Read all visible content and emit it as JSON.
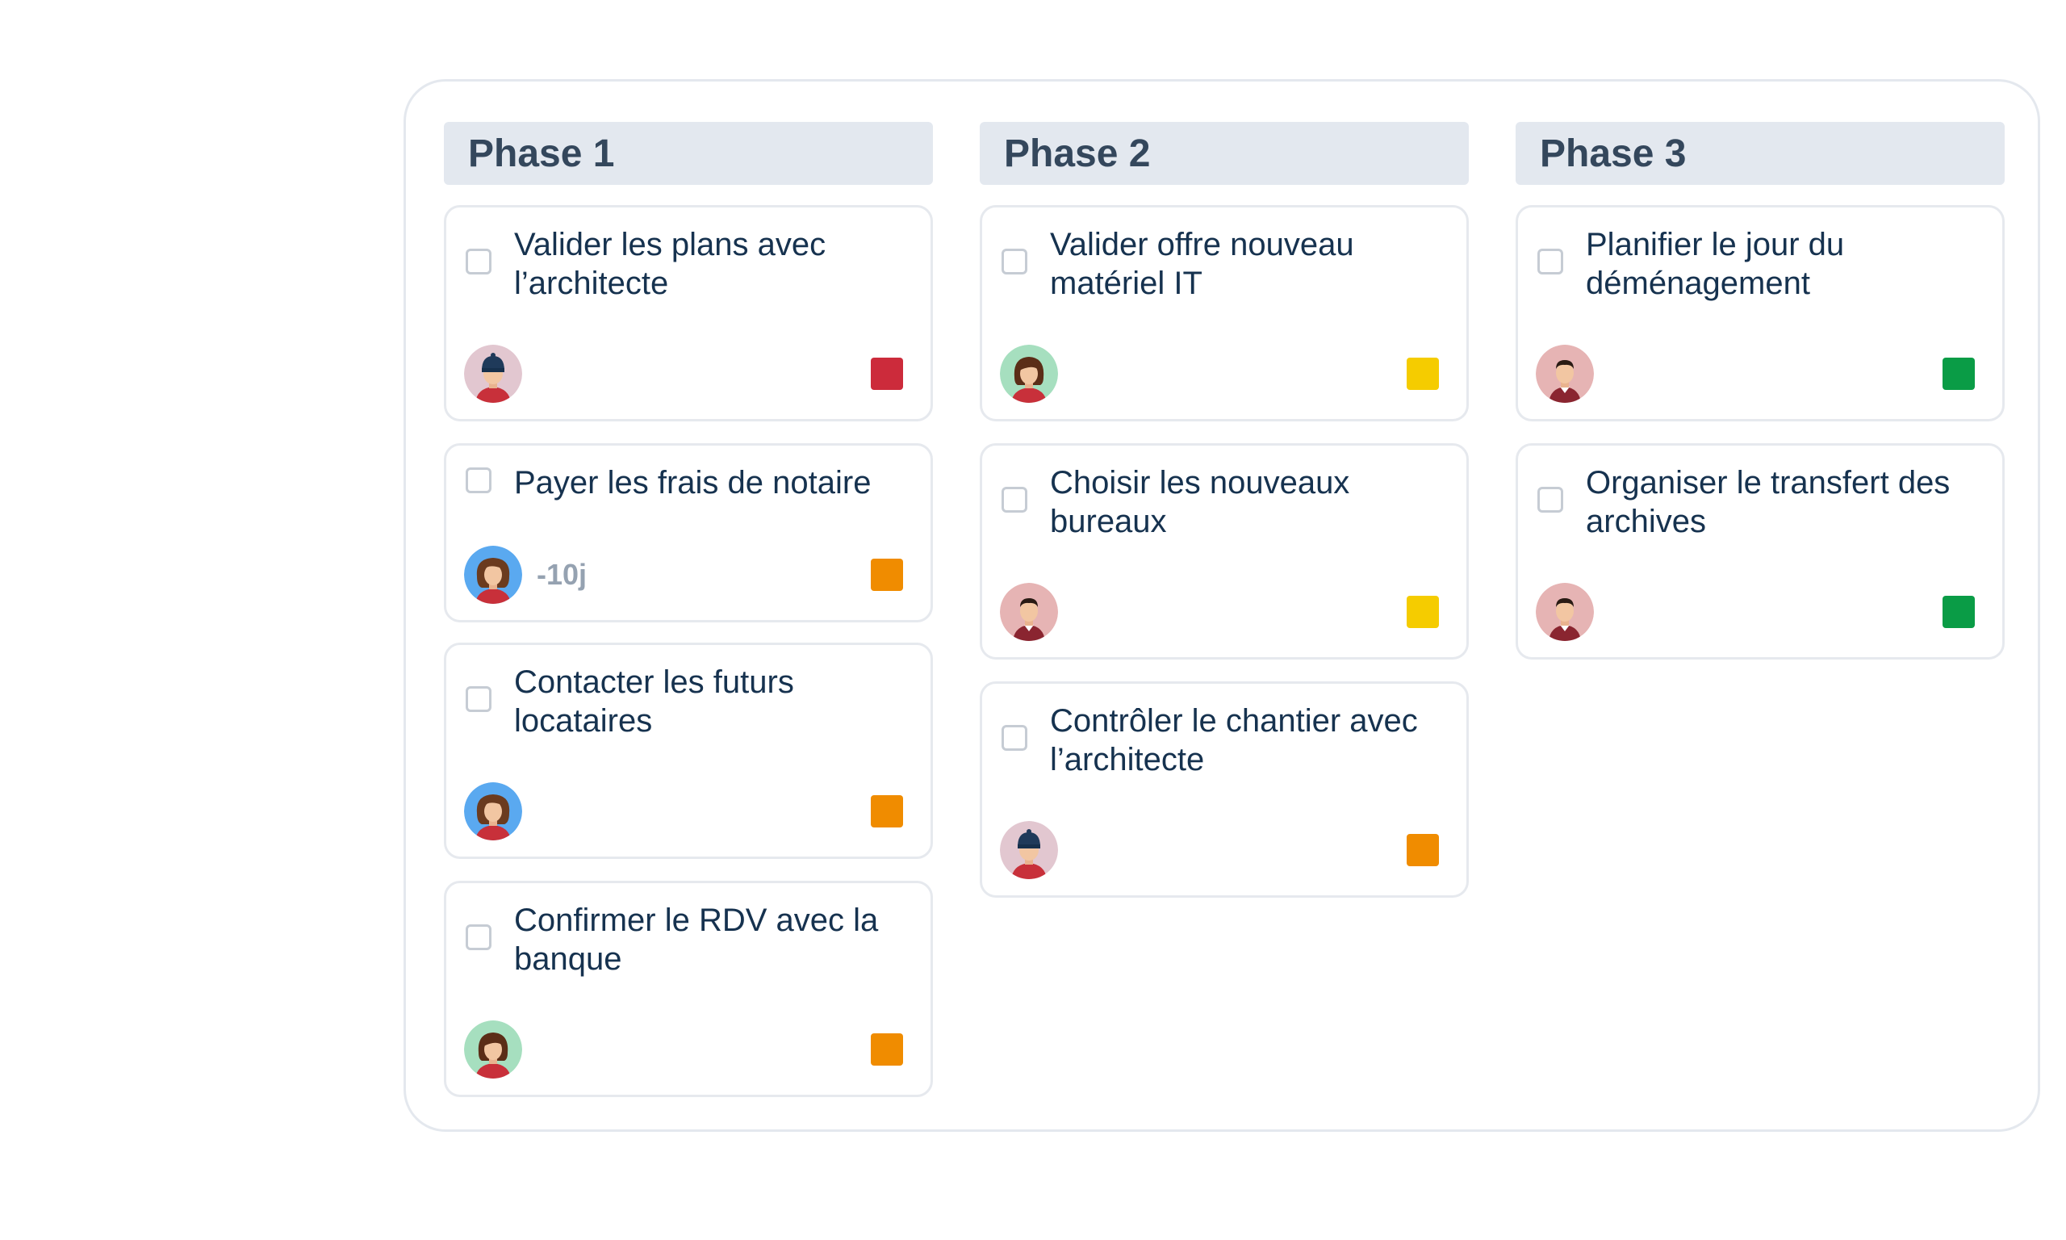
{
  "columns": [
    {
      "title": "Phase 1",
      "cards": [
        {
          "title": "Valider les plans avec l’architecte",
          "avatar": "avatar-woman-beanie",
          "priority_color": "#cc2b3b",
          "delay": ""
        },
        {
          "title": "Payer les frais de notaire",
          "avatar": "avatar-woman-blue-bg",
          "priority_color": "#f08c00",
          "delay": "-10j"
        },
        {
          "title": "Contacter les futurs locataires",
          "avatar": "avatar-woman-blue-bg",
          "priority_color": "#f08c00",
          "delay": ""
        },
        {
          "title": "Confirmer le RDV avec la banque",
          "avatar": "avatar-woman-green-bg",
          "priority_color": "#f08c00",
          "delay": ""
        }
      ]
    },
    {
      "title": "Phase 2",
      "cards": [
        {
          "title": "Valider offre nouveau matériel IT",
          "avatar": "avatar-woman-green-bg",
          "priority_color": "#f5cc00",
          "delay": ""
        },
        {
          "title": "Choisir les nouveaux bureaux",
          "avatar": "avatar-man-pink-bg",
          "priority_color": "#f5cc00",
          "delay": ""
        },
        {
          "title": "Contrôler le chantier avec l’architecte",
          "avatar": "avatar-woman-beanie",
          "priority_color": "#f08c00",
          "delay": ""
        }
      ]
    },
    {
      "title": "Phase 3",
      "cards": [
        {
          "title": "Planifier le jour du déménagement",
          "avatar": "avatar-man-pink-bg",
          "priority_color": "#0a9c46",
          "delay": ""
        },
        {
          "title": "Organiser le transfert des archives",
          "avatar": "avatar-man-pink-bg",
          "priority_color": "#0a9c46",
          "delay": ""
        }
      ]
    }
  ]
}
